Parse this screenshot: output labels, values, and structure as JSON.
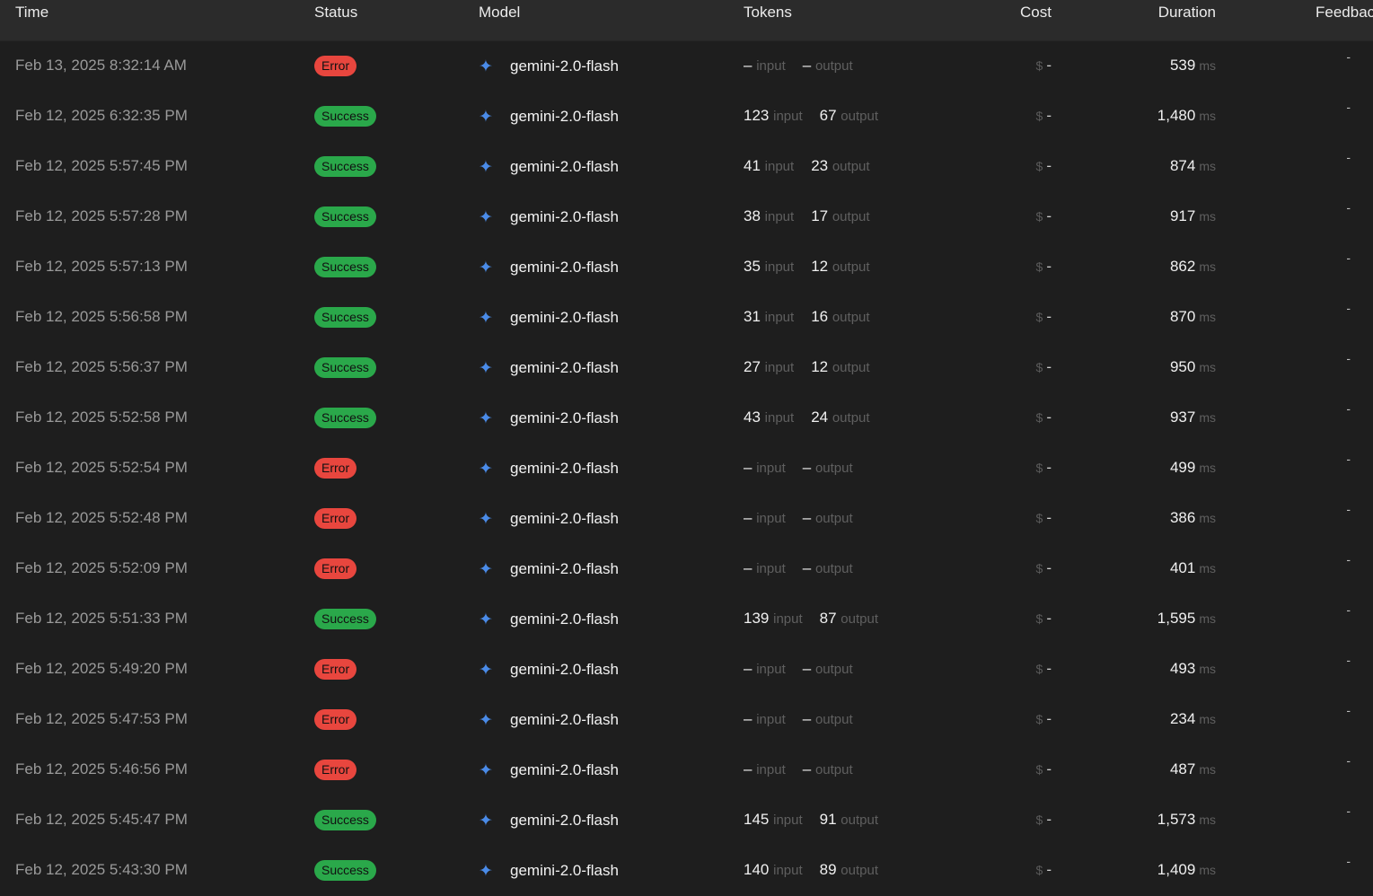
{
  "header": {
    "time": "Time",
    "status": "Status",
    "model": "Model",
    "tokens": "Tokens",
    "cost": "Cost",
    "duration": "Duration",
    "feedback": "Feedbac"
  },
  "labels": {
    "input": "input",
    "output": "output",
    "currency": "$",
    "ms": "ms"
  },
  "colors": {
    "success": "#2aa84a",
    "error": "#e8463e",
    "model_icon": "#4a8be8"
  },
  "rows": [
    {
      "time": "Feb 13, 2025 8:32:14 AM",
      "status": "Error",
      "model": "gemini-2.0-flash",
      "input": "–",
      "output": "–",
      "cost": "-",
      "duration": "539",
      "feedback": "-"
    },
    {
      "time": "Feb 12, 2025 6:32:35 PM",
      "status": "Success",
      "model": "gemini-2.0-flash",
      "input": "123",
      "output": "67",
      "cost": "-",
      "duration": "1,480",
      "feedback": "-"
    },
    {
      "time": "Feb 12, 2025 5:57:45 PM",
      "status": "Success",
      "model": "gemini-2.0-flash",
      "input": "41",
      "output": "23",
      "cost": "-",
      "duration": "874",
      "feedback": "-"
    },
    {
      "time": "Feb 12, 2025 5:57:28 PM",
      "status": "Success",
      "model": "gemini-2.0-flash",
      "input": "38",
      "output": "17",
      "cost": "-",
      "duration": "917",
      "feedback": "-"
    },
    {
      "time": "Feb 12, 2025 5:57:13 PM",
      "status": "Success",
      "model": "gemini-2.0-flash",
      "input": "35",
      "output": "12",
      "cost": "-",
      "duration": "862",
      "feedback": "-"
    },
    {
      "time": "Feb 12, 2025 5:56:58 PM",
      "status": "Success",
      "model": "gemini-2.0-flash",
      "input": "31",
      "output": "16",
      "cost": "-",
      "duration": "870",
      "feedback": "-"
    },
    {
      "time": "Feb 12, 2025 5:56:37 PM",
      "status": "Success",
      "model": "gemini-2.0-flash",
      "input": "27",
      "output": "12",
      "cost": "-",
      "duration": "950",
      "feedback": "-"
    },
    {
      "time": "Feb 12, 2025 5:52:58 PM",
      "status": "Success",
      "model": "gemini-2.0-flash",
      "input": "43",
      "output": "24",
      "cost": "-",
      "duration": "937",
      "feedback": "-"
    },
    {
      "time": "Feb 12, 2025 5:52:54 PM",
      "status": "Error",
      "model": "gemini-2.0-flash",
      "input": "–",
      "output": "–",
      "cost": "-",
      "duration": "499",
      "feedback": "-"
    },
    {
      "time": "Feb 12, 2025 5:52:48 PM",
      "status": "Error",
      "model": "gemini-2.0-flash",
      "input": "–",
      "output": "–",
      "cost": "-",
      "duration": "386",
      "feedback": "-"
    },
    {
      "time": "Feb 12, 2025 5:52:09 PM",
      "status": "Error",
      "model": "gemini-2.0-flash",
      "input": "–",
      "output": "–",
      "cost": "-",
      "duration": "401",
      "feedback": "-"
    },
    {
      "time": "Feb 12, 2025 5:51:33 PM",
      "status": "Success",
      "model": "gemini-2.0-flash",
      "input": "139",
      "output": "87",
      "cost": "-",
      "duration": "1,595",
      "feedback": "-"
    },
    {
      "time": "Feb 12, 2025 5:49:20 PM",
      "status": "Error",
      "model": "gemini-2.0-flash",
      "input": "–",
      "output": "–",
      "cost": "-",
      "duration": "493",
      "feedback": "-"
    },
    {
      "time": "Feb 12, 2025 5:47:53 PM",
      "status": "Error",
      "model": "gemini-2.0-flash",
      "input": "–",
      "output": "–",
      "cost": "-",
      "duration": "234",
      "feedback": "-"
    },
    {
      "time": "Feb 12, 2025 5:46:56 PM",
      "status": "Error",
      "model": "gemini-2.0-flash",
      "input": "–",
      "output": "–",
      "cost": "-",
      "duration": "487",
      "feedback": "-"
    },
    {
      "time": "Feb 12, 2025 5:45:47 PM",
      "status": "Success",
      "model": "gemini-2.0-flash",
      "input": "145",
      "output": "91",
      "cost": "-",
      "duration": "1,573",
      "feedback": "-"
    },
    {
      "time": "Feb 12, 2025 5:43:30 PM",
      "status": "Success",
      "model": "gemini-2.0-flash",
      "input": "140",
      "output": "89",
      "cost": "-",
      "duration": "1,409",
      "feedback": "-"
    }
  ]
}
